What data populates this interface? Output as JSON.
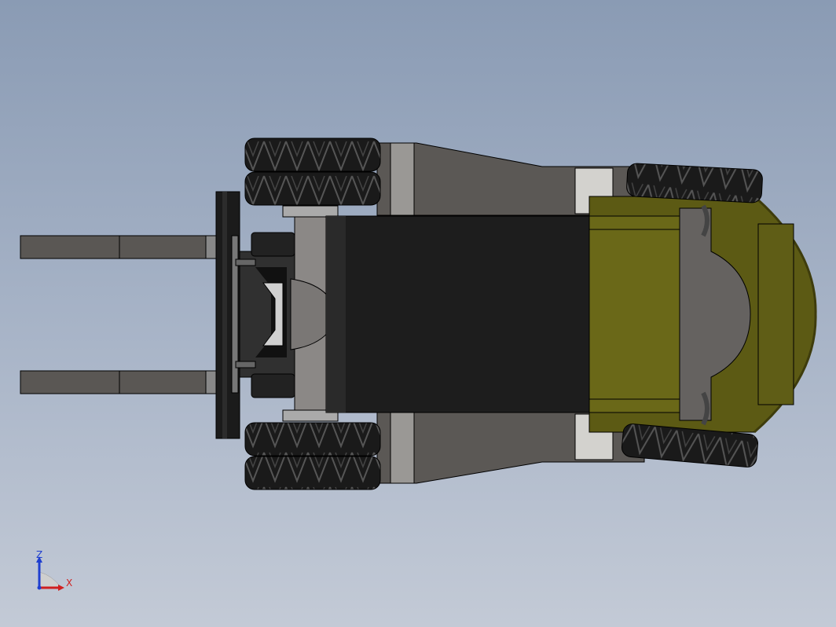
{
  "scene": {
    "colors": {
      "background_top": "#8a9bb4",
      "background_bottom": "#c3cad6",
      "body": "#5b5855",
      "body_light": "#d3d2ce",
      "chassis_dark": "#1d1d1d",
      "counterweight": "#5c5a14",
      "tire": "#1a1a1a",
      "fork": "#5a5754",
      "outline": "#000000"
    }
  },
  "triad": {
    "z_label": "Z",
    "x_label": "X",
    "z_color": "#1f3fd0",
    "x_color": "#d02020"
  }
}
